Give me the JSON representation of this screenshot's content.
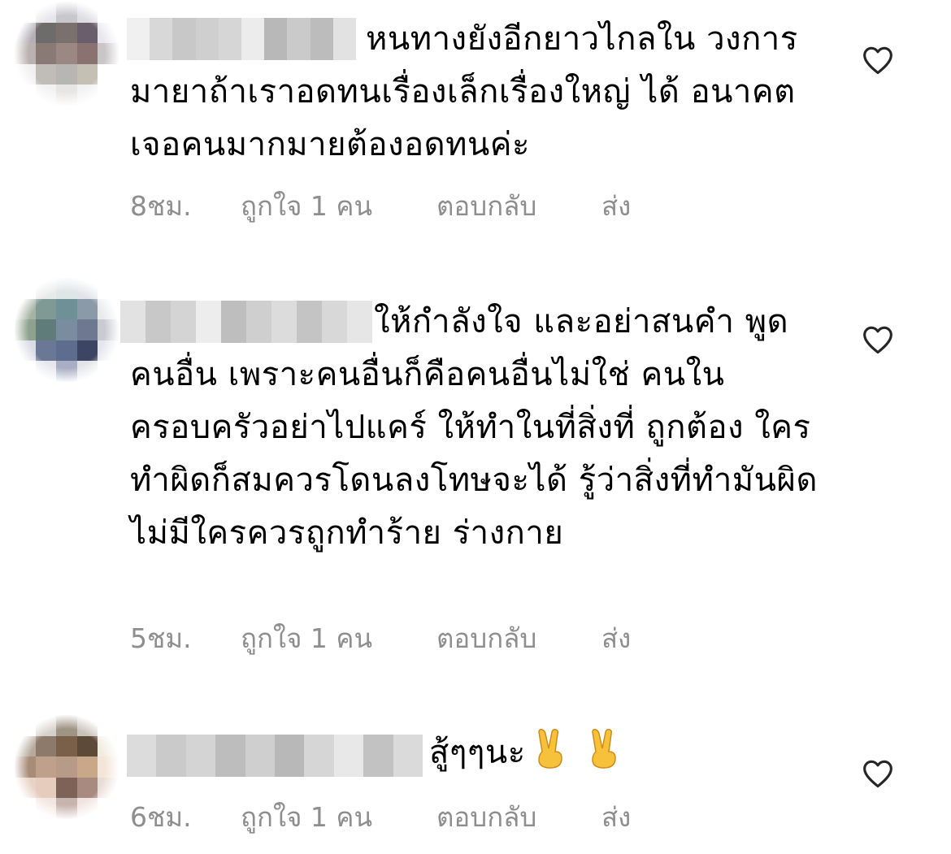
{
  "comments": [
    {
      "text": "หนทางยังอีกยาวไกลใน วงการมายาถ้าเราอดทนเรื่องเล็กเรื่องใหญ่ ได้ อนาคตเจอคนมากมายต้องอดทนค่ะ",
      "time": "8ชม.",
      "likes": "ถูกใจ 1 คน",
      "reply": "ตอบกลับ",
      "send": "ส่ง",
      "avatar_colors": [
        "#ffffff",
        "#e6e6ea",
        "#c8c8cc",
        "#dcdce2",
        "#ffffff",
        "#b4b0b6",
        "#6e6c6a",
        "#7a706e",
        "#6a5e6c",
        "#e8e6ec",
        "#bab2b0",
        "#8a7a76",
        "#9c8882",
        "#8a7270",
        "#c8c6c6",
        "#f0f0f0",
        "#c0bcb8",
        "#b8b6b2",
        "#c4c0b4",
        "#ffffff",
        "#ffffff",
        "#f2f2f2",
        "#e8e6e4",
        "#f2f2f2",
        "#ffffff"
      ],
      "username_colors": [
        "#f0f0f0",
        "#d8d8d8",
        "#c8c8c8",
        "#cfcfcf",
        "#d6d6d6",
        "#ececec",
        "#b8b8b8",
        "#cacaca",
        "#bcbcbc",
        "#e2e2e2"
      ]
    },
    {
      "text": "ให้กำลังใจ และอย่าสนคำ พูดคนอื่น เพราะคนอื่นก็คือคนอื่นไม่ใช่ คนในครอบครัวอย่าไปแคร์ ให้ทำในที่สิ่งที่ ถูกต้อง ใครทำผิดก็สมควรโดนลงโทษจะได้ รู้ว่าสิ่งที่ทำมันผิด ไม่มีใครควรถูกทำร้าย ร่างกาย",
      "time": "5ชม.",
      "likes": "ถูกใจ 1 คน",
      "reply": "ตอบกลับ",
      "send": "ส่ง",
      "avatar_colors": [
        "#ffffff",
        "#e6ebe8",
        "#dfe6e6",
        "#e2e4ea",
        "#ffffff",
        "#a6b2a6",
        "#7f9a94",
        "#6f9096",
        "#8a9aa8",
        "#e8eaec",
        "#8ea28e",
        "#5f7c7a",
        "#7a8ca0",
        "#6e7890",
        "#c8ccd2",
        "#d8dce4",
        "#6a7896",
        "#5e6c8e",
        "#3c4664",
        "#e4e6ee",
        "#ffffff",
        "#e6e8ee",
        "#a8aec4",
        "#e2e4ea",
        "#ffffff"
      ],
      "username_colors": [
        "#e2e2e2",
        "#c8c8c8",
        "#d4d4d4",
        "#ededed",
        "#bebebe",
        "#cfcfcf",
        "#dcdcdc",
        "#c4c4c4",
        "#d8d8d8",
        "#e6e6e6"
      ]
    },
    {
      "text": "สู้ๆๆนะ",
      "time": "6ชม.",
      "likes": "ถูกใจ 1 คน",
      "reply": "ตอบกลับ",
      "send": "ส่ง",
      "emoji": [
        "victory-hand",
        "victory-hand"
      ],
      "avatar_colors": [
        "#ffffff",
        "#d4d0ca",
        "#a09484",
        "#c8c2b8",
        "#ffffff",
        "#b6aa9c",
        "#8e7a6a",
        "#7a6048",
        "#5e4a38",
        "#f2ece0",
        "#a88c78",
        "#bfa08a",
        "#b89a88",
        "#c8a888",
        "#f4e6d6",
        "#e8d2c4",
        "#e6ccbc",
        "#7e6258",
        "#a88a80",
        "#e8dcd6",
        "#ffffff",
        "#f2e6e2",
        "#c8b4ae",
        "#f0e4e0",
        "#ffffff"
      ],
      "username_colors": [
        "#dcdcdc",
        "#cacaca",
        "#d4d4d4",
        "#bdbdbd",
        "#cfcfcf",
        "#b8b8b8",
        "#d6d6d6",
        "#e8e8e8",
        "#c2c2c2",
        "#dadada"
      ]
    }
  ],
  "colors": {
    "meta_text": "#8e8e8e",
    "body_text": "#000000",
    "icon_stroke": "#262626"
  },
  "icons": {
    "like": "heart-outline-icon",
    "emoji": "victory-hand-emoji"
  }
}
